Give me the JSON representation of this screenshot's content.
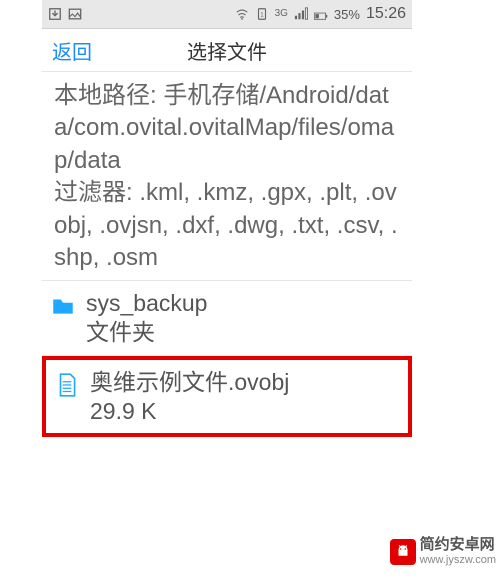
{
  "statusbar": {
    "battery_pct": "35%",
    "clock": "15:26",
    "network_label": "3G"
  },
  "topbar": {
    "back": "返回",
    "title": "选择文件"
  },
  "info": {
    "path_label": "本地路径:",
    "path_value": "手机存储/Android/data/com.ovital.ovitalMap/files/omap/data",
    "filter_label": "过滤器:",
    "filter_value": ".kml, .kmz, .gpx, .plt, .ovobj, .ovjsn, .dxf, .dwg, .txt, .csv, .shp, .osm"
  },
  "files": [
    {
      "name": "sys_backup",
      "subtitle": "文件夹",
      "type": "folder"
    },
    {
      "name": "奥维示例文件.ovobj",
      "subtitle": "29.9 K",
      "type": "file"
    }
  ],
  "watermark": {
    "name": "简约安卓网",
    "url": "www.jyszw.com"
  }
}
